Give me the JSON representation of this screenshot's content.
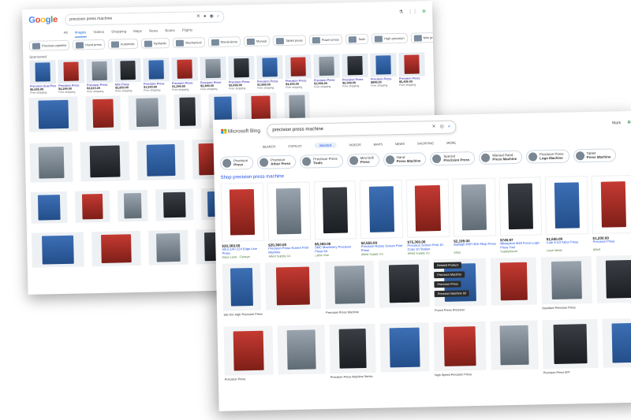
{
  "google": {
    "logo": "Google",
    "query": "precision press machine",
    "tabs": [
      "All",
      "Images",
      "Videos",
      "Shopping",
      "Maps",
      "News",
      "Books",
      "Flights"
    ],
    "active_tab": "Images",
    "chips": [
      "Precision pipeline",
      "Hand press",
      "Automatic",
      "Hydraulic",
      "Mechanical",
      "Stand-alone",
      "Manual",
      "Tablet press",
      "Power press",
      "Tools",
      "High precision",
      "Mini press"
    ],
    "sponsored": "Sponsored",
    "ads": [
      {
        "title": "Precision Dual Press",
        "price": "$6,599.99",
        "store": "Free shipping"
      },
      {
        "title": "Precision Press",
        "price": "$4,299.00",
        "store": "Free shipping"
      },
      {
        "title": "Precision Press",
        "price": "$3,815.00",
        "store": "Free shipping"
      },
      {
        "title": "Mini Press",
        "price": "$2,850.00",
        "store": "Free shipping"
      },
      {
        "title": "Precision Press",
        "price": "$1,530.90",
        "store": "Free shipping"
      },
      {
        "title": "Precision Press",
        "price": "$1,299.90",
        "store": "Free shipping"
      },
      {
        "title": "Precision Press",
        "price": "$2,489.00",
        "store": "Free shipping"
      },
      {
        "title": "Precision Press",
        "price": "$3,699.00",
        "store": "Free shipping"
      },
      {
        "title": "Precision Press",
        "price": "$1,689.00",
        "store": "Free shipping"
      },
      {
        "title": "Precision Press",
        "price": "$4,200.00",
        "store": "Free shipping"
      },
      {
        "title": "Precision Press",
        "price": "$1,999.00",
        "store": "Free shipping"
      },
      {
        "title": "Precision Press",
        "price": "$2,349.00",
        "store": "Free shipping"
      },
      {
        "title": "Precision Press",
        "price": "$899.00",
        "store": "Free shipping"
      },
      {
        "title": "Precision Press",
        "price": "$5,409.00",
        "store": "Free shipping"
      }
    ]
  },
  "bing": {
    "logo": "Microsoft Bing",
    "query": "precision press machine",
    "tabs": [
      "SEARCH",
      "COPILOT",
      "IMAGES",
      "VIDEOS",
      "MAPS",
      "NEWS",
      "SHOPPING",
      "MORE"
    ],
    "active_tab": "IMAGES",
    "chips": [
      {
        "l1": "Precision",
        "l2": "Press"
      },
      {
        "l1": "Precision",
        "l2": "Arbor Press"
      },
      {
        "l1": "Precision Press",
        "l2": "Tools"
      },
      {
        "l1": "Mini Drill",
        "l2": "Press"
      },
      {
        "l1": "Hand",
        "l2": "Press Machine"
      },
      {
        "l1": "Special",
        "l2": "Precision Press"
      },
      {
        "l1": "Manual Hand",
        "l2": "Press Machine"
      },
      {
        "l1": "Precision Press",
        "l2": "Logo Machine"
      },
      {
        "l1": "Tablet",
        "l2": "Press Machine"
      }
    ],
    "shop_label": "Shop precision press machine",
    "products": [
      {
        "price": "$20,360.00",
        "title": "Ultra ZAP-224 Edge Line Press",
        "seller": "Mass Land · Fisheye"
      },
      {
        "price": "$20,360.00",
        "title": "Precision Press Screen Print Machine",
        "seller": "Allied Supply Co"
      },
      {
        "price": "$8,360.00",
        "title": "SMC Machinery Precision Press Kit",
        "seller": "Lathe Vise"
      },
      {
        "price": "$2,550.00",
        "title": "Precision Rotary Screen Print Press",
        "seller": "Allied Supply Co"
      },
      {
        "price": "$75,360.00",
        "title": "Precision Screen Print 10 Color 10 Station",
        "seller": "Allied Supply Co"
      },
      {
        "price": "$2,199.00",
        "title": "Baileigh HSP-30A Shop Press",
        "seller": "Ebay"
      },
      {
        "price": "$749.97",
        "title": "Milwaukee M18 Force Logic Press Tool",
        "seller": "Supplyhouse"
      },
      {
        "price": "$1,600.00",
        "title": "Cole 3-1/2 Arbor Press",
        "seller": "Lowe Metal"
      },
      {
        "price": "$1,200.00",
        "title": "Precision Press",
        "seller": "Allied"
      }
    ],
    "menu_items": [
      "Related Product",
      "Precision Machine",
      "Precision Press",
      "Precision Machine 60"
    ],
    "captions": [
      "160 Ton High Precision Press",
      "Precision Press Machine",
      "Punch Press Precision",
      "Standard Precision Press",
      "Precision Press",
      "Precision Press Machine Series",
      "High Speed Precision Press",
      "Precision Press 60T",
      "High Precision Power Press",
      "Precision Press Machine",
      "Precision Press Line",
      "Precision Press Machine"
    ]
  }
}
